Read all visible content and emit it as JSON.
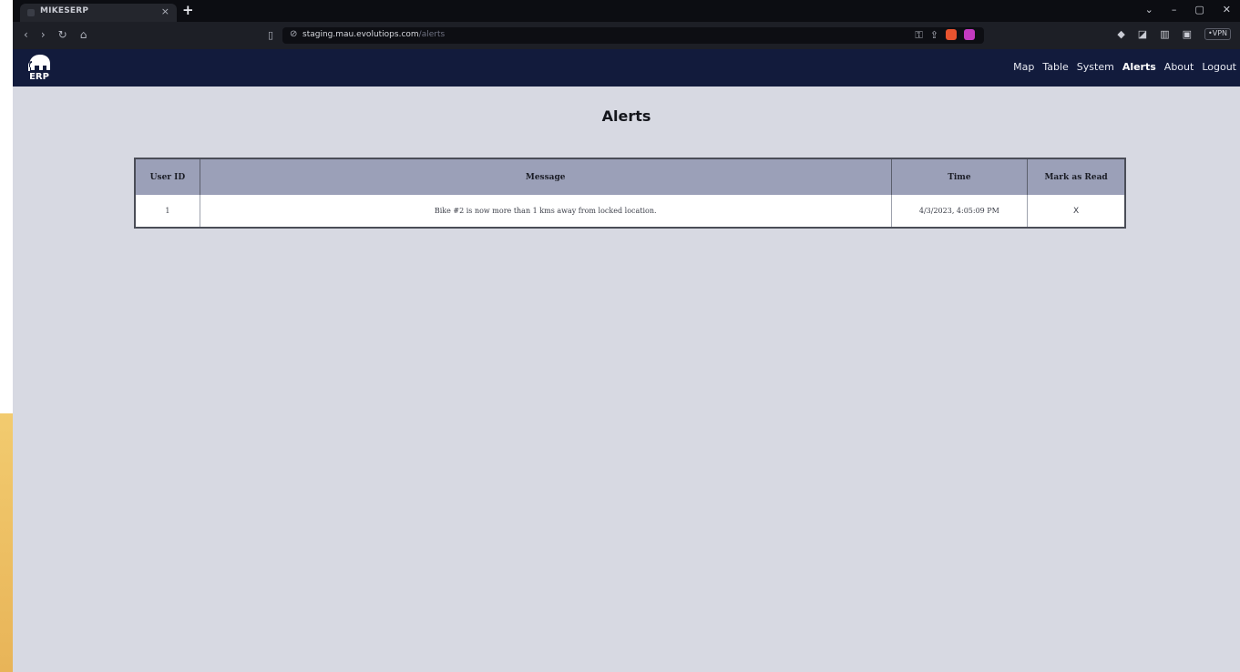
{
  "browser": {
    "tab_title": "MIKESERP",
    "tab_close": "×",
    "new_tab": "+",
    "window_controls": [
      "⌄",
      "–",
      "▢",
      "✕"
    ],
    "nav_buttons": [
      "‹",
      "›",
      "↻",
      "⌂"
    ],
    "url_host": "staging.mau.evolutiops.com",
    "url_path": "/alerts",
    "extension_icons": [
      "◆",
      "◪",
      "▥",
      "▣"
    ],
    "vpn_label": "•VPN"
  },
  "app": {
    "logo_label": "ERP",
    "nav": [
      {
        "label": "Map"
      },
      {
        "label": "Table"
      },
      {
        "label": "System"
      },
      {
        "label": "Alerts",
        "active": true
      },
      {
        "label": "About"
      },
      {
        "label": "Logout"
      }
    ]
  },
  "page": {
    "title": "Alerts",
    "table": {
      "headers": [
        "User ID",
        "Message",
        "Time",
        "Mark as Read"
      ],
      "rows": [
        [
          "1",
          "Bike #2 is now more than 1 kms away from locked location.",
          "4/3/2023, 4:05:09 PM",
          "X"
        ]
      ]
    }
  },
  "colors": {
    "navbar": "#121b3c",
    "page_bg": "#d7d9e2",
    "table_header": "#9ba0b8"
  }
}
